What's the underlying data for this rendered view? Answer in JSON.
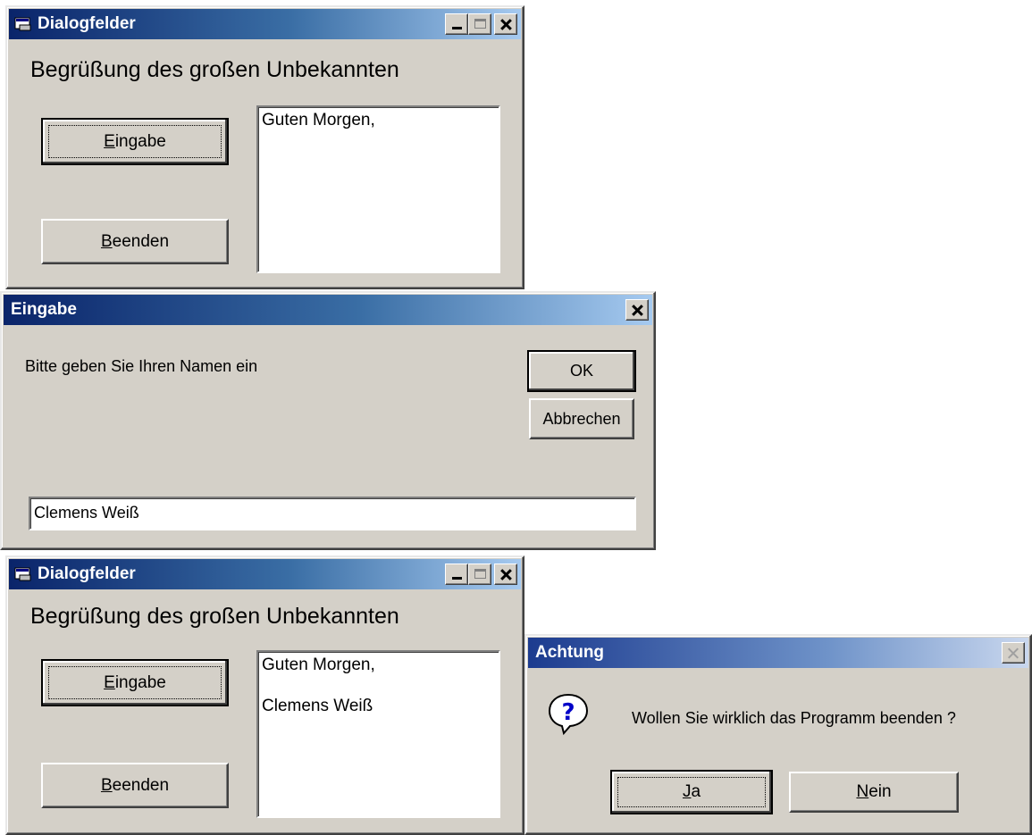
{
  "window_top": {
    "title": "Dialogfelder",
    "heading": "Begrüßung des großen Unbekannten",
    "eingabe_button": {
      "pre": "",
      "accel": "E",
      "post": "ingabe"
    },
    "beenden_button": {
      "pre": "",
      "accel": "B",
      "post": "eenden"
    },
    "output_lines": [
      "Guten Morgen,"
    ]
  },
  "input_dialog": {
    "title": "Eingabe",
    "prompt": "Bitte geben Sie Ihren Namen ein",
    "ok_label": "OK",
    "cancel_label": "Abbrechen",
    "input_value": "Clemens Weiß"
  },
  "window_bottom": {
    "title": "Dialogfelder",
    "heading": "Begrüßung des großen Unbekannten",
    "eingabe_button": {
      "pre": "",
      "accel": "E",
      "post": "ingabe"
    },
    "beenden_button": {
      "pre": "",
      "accel": "B",
      "post": "eenden"
    },
    "output_lines": [
      "Guten Morgen,",
      "Clemens Weiß"
    ]
  },
  "confirm_dialog": {
    "title": "Achtung",
    "icon": "question-icon",
    "message": "Wollen Sie wirklich das Programm beenden ?",
    "yes_button": {
      "pre": "",
      "accel": "J",
      "post": "a"
    },
    "no_button": {
      "pre": "",
      "accel": "N",
      "post": "ein"
    }
  },
  "colors": {
    "face": "#d4d0c8",
    "title_active_start": "#0a246a",
    "title_active_end": "#a6caf0"
  }
}
